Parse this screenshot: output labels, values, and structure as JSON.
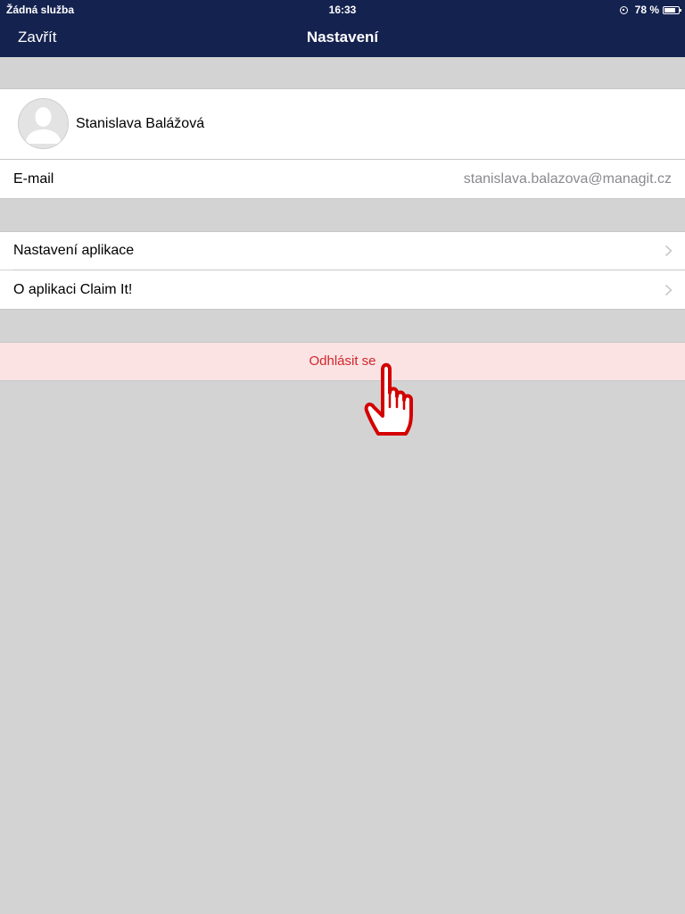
{
  "status_bar": {
    "carrier": "Žádná služba",
    "time": "16:33",
    "battery": "78 %",
    "battery_level": 0.78
  },
  "nav": {
    "close_label": "Zavřít",
    "title": "Nastavení"
  },
  "profile": {
    "name": "Stanislava Balážová",
    "avatar_icon": "user-silhouette-icon"
  },
  "email": {
    "label": "E-mail",
    "value": "stanislava.balazova@managit.cz"
  },
  "menu": {
    "items": [
      {
        "label": "Nastavení aplikace",
        "icon": "chevron-right-icon"
      },
      {
        "label": "O aplikaci Claim It!",
        "icon": "chevron-right-icon"
      }
    ]
  },
  "logout": {
    "label": "Odhlásit se"
  },
  "colors": {
    "nav_background": "#14224f",
    "page_background": "#d3d3d3",
    "logout_background": "#fbe3e4",
    "logout_text": "#d0262b",
    "secondary_text": "#8a8a8f",
    "pointer": "#d40000"
  },
  "overlay": {
    "pointer_icon": "hand-pointer-icon"
  }
}
